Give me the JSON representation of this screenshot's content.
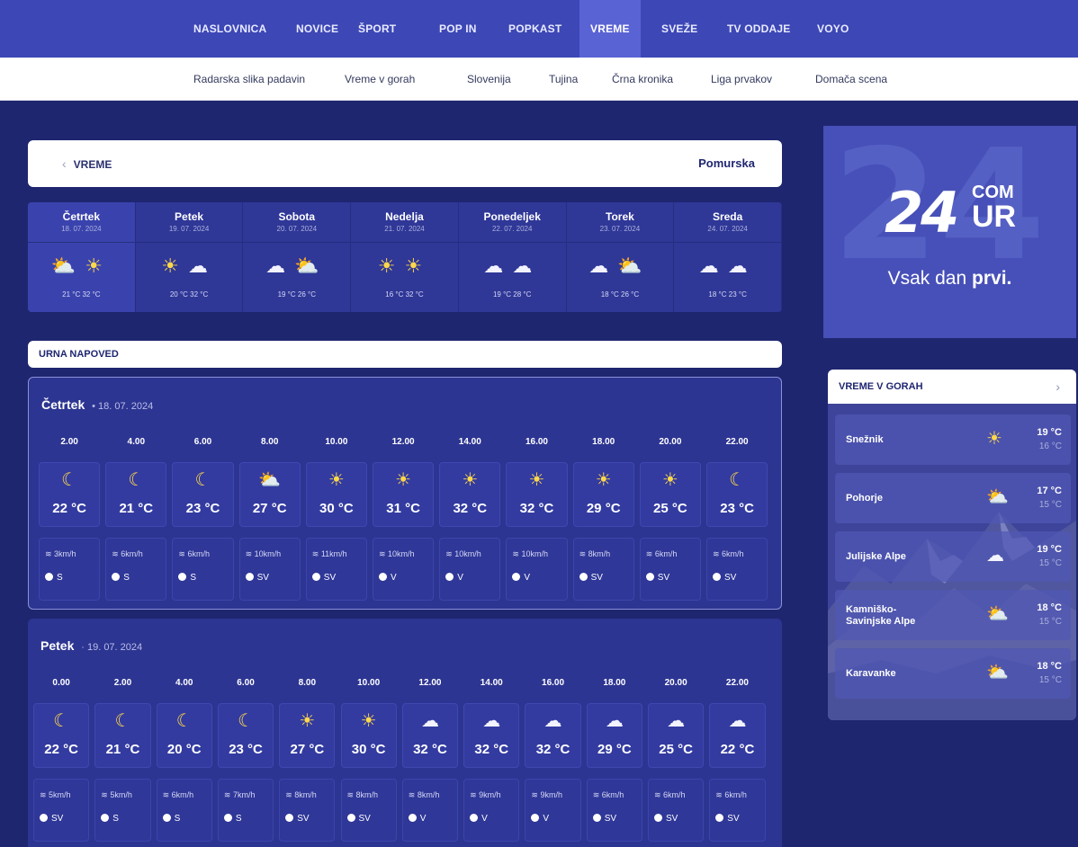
{
  "nav": {
    "items": [
      "NASLOVNICA",
      "NOVICE",
      "ŠPORT",
      "POP IN",
      "POPKAST",
      "VREME",
      "SVEŽE",
      "TV ODDAJE",
      "VOYO"
    ],
    "active": "VREME"
  },
  "subnav": {
    "items": [
      "Radarska slika padavin",
      "Vreme v gorah",
      "Slovenija",
      "Tujina",
      "Črna kronika",
      "Liga prvakov",
      "Domača scena"
    ]
  },
  "header": {
    "back_label": "VREME",
    "region": "Pomurska"
  },
  "days": [
    {
      "name": "Četrtek",
      "date": "18. 07. 2024",
      "icons": [
        "partly-sunny",
        "sun"
      ],
      "temps": "21 °C  32 °C"
    },
    {
      "name": "Petek",
      "date": "19. 07. 2024",
      "icons": [
        "sun",
        "cloudy"
      ],
      "temps": "20 °C  32 °C"
    },
    {
      "name": "Sobota",
      "date": "20. 07. 2024",
      "icons": [
        "cloudy",
        "partly-sunny"
      ],
      "temps": "19 °C  26 °C"
    },
    {
      "name": "Nedelja",
      "date": "21. 07. 2024",
      "icons": [
        "sun",
        "sun"
      ],
      "temps": "16 °C  32 °C"
    },
    {
      "name": "Ponedeljek",
      "date": "22. 07. 2024",
      "icons": [
        "cloudy",
        "cloudy"
      ],
      "temps": "19 °C  28 °C"
    },
    {
      "name": "Torek",
      "date": "23. 07. 2024",
      "icons": [
        "cloudy",
        "partly-sunny"
      ],
      "temps": "18 °C  26 °C"
    },
    {
      "name": "Sreda",
      "date": "24. 07. 2024",
      "icons": [
        "cloudy",
        "cloudy"
      ],
      "temps": "18 °C  23 °C"
    }
  ],
  "hourly": {
    "title": "URNA NAPOVED",
    "panels": [
      {
        "day": "Četrtek",
        "date": "• 18. 07. 2024",
        "hours": [
          {
            "time": "2.00",
            "icon": "moon-cloud",
            "temp": "22 °C",
            "wind": "3km/h",
            "dir": "S"
          },
          {
            "time": "4.00",
            "icon": "moon-cloud",
            "temp": "21 °C",
            "wind": "6km/h",
            "dir": "S"
          },
          {
            "time": "6.00",
            "icon": "moon-cloud",
            "temp": "23 °C",
            "wind": "6km/h",
            "dir": "S"
          },
          {
            "time": "8.00",
            "icon": "partly-sunny",
            "temp": "27 °C",
            "wind": "10km/h",
            "dir": "SV"
          },
          {
            "time": "10.00",
            "icon": "sun",
            "temp": "30 °C",
            "wind": "11km/h",
            "dir": "SV"
          },
          {
            "time": "12.00",
            "icon": "sun",
            "temp": "31 °C",
            "wind": "10km/h",
            "dir": "V"
          },
          {
            "time": "14.00",
            "icon": "sun",
            "temp": "32 °C",
            "wind": "10km/h",
            "dir": "V"
          },
          {
            "time": "16.00",
            "icon": "sun",
            "temp": "32 °C",
            "wind": "10km/h",
            "dir": "V"
          },
          {
            "time": "18.00",
            "icon": "sun",
            "temp": "29 °C",
            "wind": "8km/h",
            "dir": "SV"
          },
          {
            "time": "20.00",
            "icon": "sun",
            "temp": "25 °C",
            "wind": "6km/h",
            "dir": "SV"
          },
          {
            "time": "22.00",
            "icon": "moon",
            "temp": "23 °C",
            "wind": "6km/h",
            "dir": "SV"
          }
        ]
      },
      {
        "day": "Petek",
        "date": "· 19. 07. 2024",
        "hours": [
          {
            "time": "0.00",
            "icon": "moon",
            "temp": "22 °C",
            "wind": "5km/h",
            "dir": "SV"
          },
          {
            "time": "2.00",
            "icon": "moon",
            "temp": "21 °C",
            "wind": "5km/h",
            "dir": "S"
          },
          {
            "time": "4.00",
            "icon": "moon",
            "temp": "20 °C",
            "wind": "6km/h",
            "dir": "S"
          },
          {
            "time": "6.00",
            "icon": "moon",
            "temp": "23 °C",
            "wind": "7km/h",
            "dir": "S"
          },
          {
            "time": "8.00",
            "icon": "sun",
            "temp": "27 °C",
            "wind": "8km/h",
            "dir": "SV"
          },
          {
            "time": "10.00",
            "icon": "sun",
            "temp": "30 °C",
            "wind": "8km/h",
            "dir": "SV"
          },
          {
            "time": "12.00",
            "icon": "cloudy",
            "temp": "32 °C",
            "wind": "8km/h",
            "dir": "V"
          },
          {
            "time": "14.00",
            "icon": "cloudy",
            "temp": "32 °C",
            "wind": "9km/h",
            "dir": "V"
          },
          {
            "time": "16.00",
            "icon": "cloudy",
            "temp": "32 °C",
            "wind": "9km/h",
            "dir": "V"
          },
          {
            "time": "18.00",
            "icon": "cloudy",
            "temp": "29 °C",
            "wind": "6km/h",
            "dir": "SV"
          },
          {
            "time": "20.00",
            "icon": "cloudy",
            "temp": "25 °C",
            "wind": "6km/h",
            "dir": "SV"
          },
          {
            "time": "22.00",
            "icon": "cloudy",
            "temp": "22 °C",
            "wind": "6km/h",
            "dir": "SV"
          }
        ]
      }
    ]
  },
  "ad": {
    "logo_main": "24",
    "logo_com": "COM",
    "logo_ur": "UR",
    "tagline_prefix": "Vsak dan ",
    "tagline_bold": "prvi."
  },
  "mountains": {
    "title": "VREME V GORAH",
    "items": [
      {
        "name": "Snežnik",
        "icon": "sun",
        "max": "19 °C",
        "min": "16 °C"
      },
      {
        "name": "Pohorje",
        "icon": "partly-sunny",
        "max": "17 °C",
        "min": "15 °C"
      },
      {
        "name": "Julijske Alpe",
        "icon": "cloudy",
        "max": "19 °C",
        "min": "15 °C"
      },
      {
        "name": "Kamniško-\nSavinjske Alpe",
        "icon": "partly-sunny",
        "max": "18 °C",
        "min": "15 °C"
      },
      {
        "name": "Karavanke",
        "icon": "partly-sunny",
        "max": "18 °C",
        "min": "15 °C"
      }
    ]
  },
  "colors": {
    "nav": "#3d47b5",
    "nav_active": "#5a63d4",
    "background": "#1f2670",
    "panel": "#2d3592",
    "sun": "#ffd84a"
  }
}
